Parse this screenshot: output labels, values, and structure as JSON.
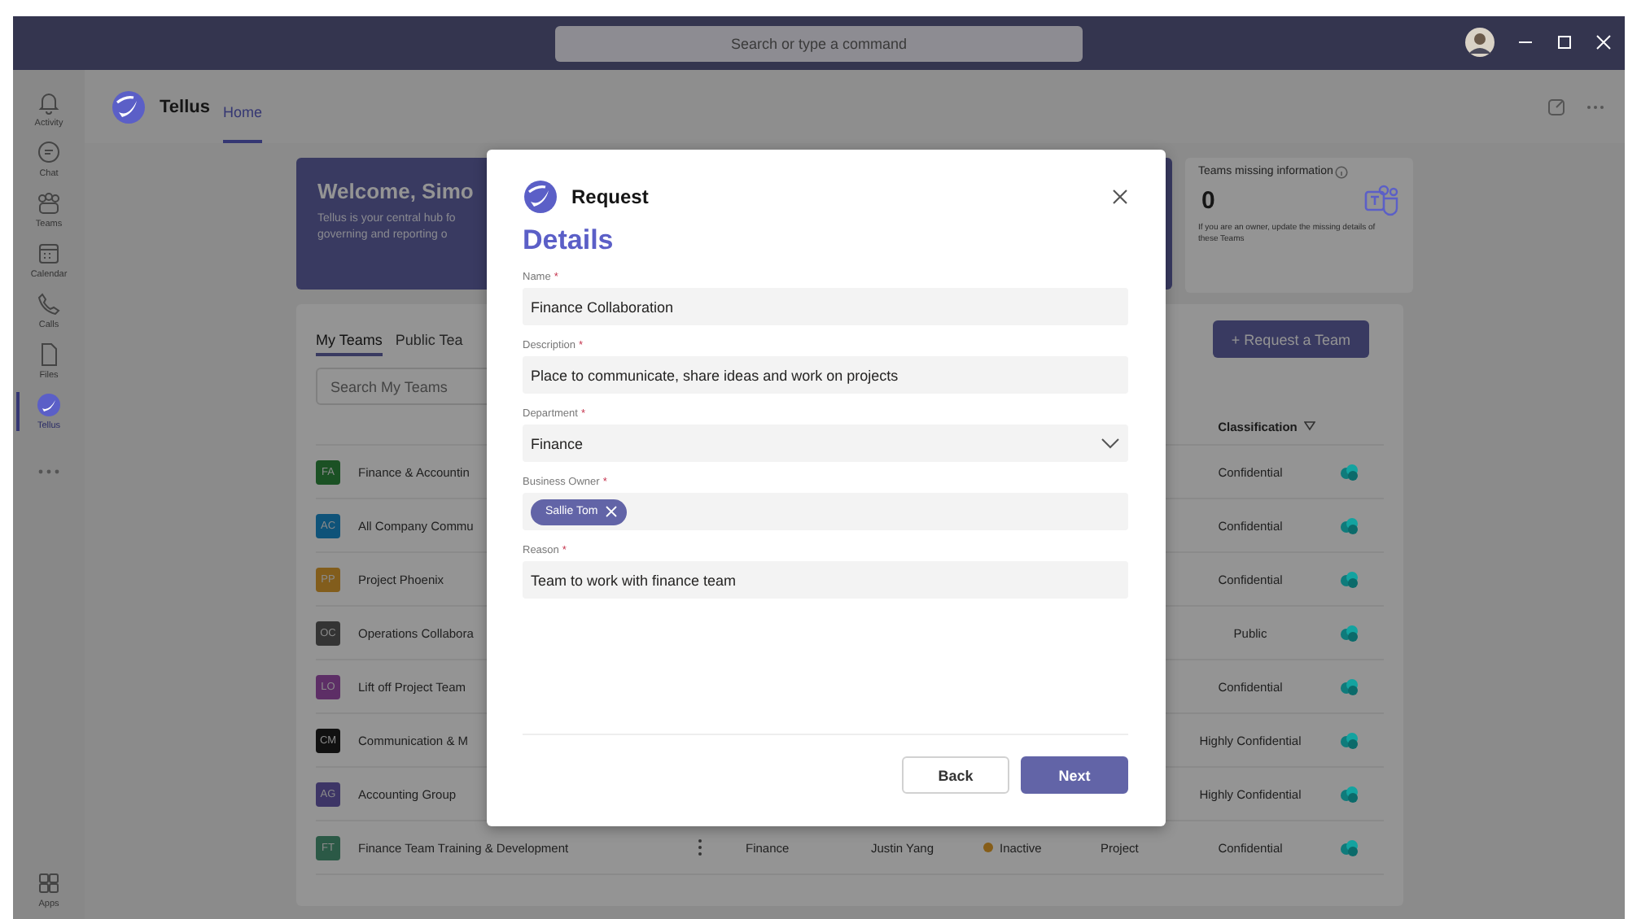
{
  "title_bar": {
    "search_placeholder": "Search or type a command"
  },
  "rail": {
    "items": [
      {
        "label": "Activity",
        "kind": "bell",
        "selected": false
      },
      {
        "label": "Chat",
        "kind": "chat",
        "selected": false
      },
      {
        "label": "Teams",
        "kind": "teams",
        "selected": false
      },
      {
        "label": "Calendar",
        "kind": "calendar",
        "selected": false
      },
      {
        "label": "Calls",
        "kind": "phone",
        "selected": false
      },
      {
        "label": "Files",
        "kind": "file",
        "selected": false
      },
      {
        "label": "Tellus",
        "kind": "tellus",
        "selected": true
      }
    ],
    "bottom_items": [
      {
        "label": "Apps",
        "kind": "apps",
        "selected": false
      }
    ]
  },
  "app_header": {
    "name": "Tellus",
    "tabs": [
      {
        "label": "Home",
        "selected": true
      }
    ]
  },
  "welcome": {
    "title": "Welcome, Simo",
    "lines": [
      "Tellus is your central hub fo",
      "governing and reporting o"
    ]
  },
  "missing_card": {
    "title": "Teams missing information",
    "count": "0",
    "note": "If you are an owner, update the missing details of these Teams"
  },
  "teams": {
    "tabs": [
      {
        "label": "My Teams",
        "selected": true
      },
      {
        "label": "Public Tea",
        "selected": false
      }
    ],
    "search_placeholder": "Search My Teams",
    "request_button": "+ Request a Team",
    "columns": [
      {
        "label": "Classification",
        "filter": true
      }
    ],
    "rows": [
      {
        "initials": "FA",
        "color": "#1b5124",
        "name": "Finance & Accountin",
        "classification": "Confidential"
      },
      {
        "initials": "AC",
        "color": "#0f5379",
        "name": "All Company Commu",
        "classification": "Confidential"
      },
      {
        "initials": "PP",
        "color": "#825d1c",
        "name": "Project Phoenix",
        "classification": "Confidential"
      },
      {
        "initials": "OC",
        "color": "#343434",
        "name": "Operations Collabora",
        "classification": "Public"
      },
      {
        "initials": "LO",
        "color": "#5d2e66",
        "name": "Lift off Project Team",
        "classification": "Confidential"
      },
      {
        "initials": "CM",
        "color": "#111111",
        "name": "Communication & M",
        "classification": "Highly Confidential"
      },
      {
        "initials": "AG",
        "color": "#3d3566",
        "name": "Accounting Group",
        "classification": "Highly Confidential"
      },
      {
        "initials": "FT",
        "color": "#2b5946",
        "name": "Finance Team Training & Development",
        "menu": true,
        "department": "Finance",
        "owner": "Justin Yang",
        "status": {
          "label": "Inactive",
          "color": "#865d18"
        },
        "type": "Project",
        "classification": "Confidential"
      }
    ]
  },
  "dialog": {
    "app_name": "Request",
    "heading": "Details",
    "fields": [
      {
        "kind": "text",
        "label": "Name",
        "required_mark": "*",
        "value": "Finance Collaboration"
      },
      {
        "kind": "text",
        "label": "Description",
        "required_mark": "*",
        "value": "Place to communicate, share ideas and work on projects"
      },
      {
        "kind": "dropdown",
        "label": "Department",
        "required_mark": "*",
        "value": "Finance"
      },
      {
        "kind": "people",
        "label": "Business Owner",
        "required_mark": "*",
        "chips": [
          "Sallie Tom"
        ]
      },
      {
        "kind": "text",
        "label": "Reason",
        "required_mark": "*",
        "value": "Team to work with finance team"
      }
    ],
    "buttons": [
      {
        "label": "Back",
        "primary": false
      },
      {
        "label": "Next",
        "primary": true
      }
    ]
  }
}
